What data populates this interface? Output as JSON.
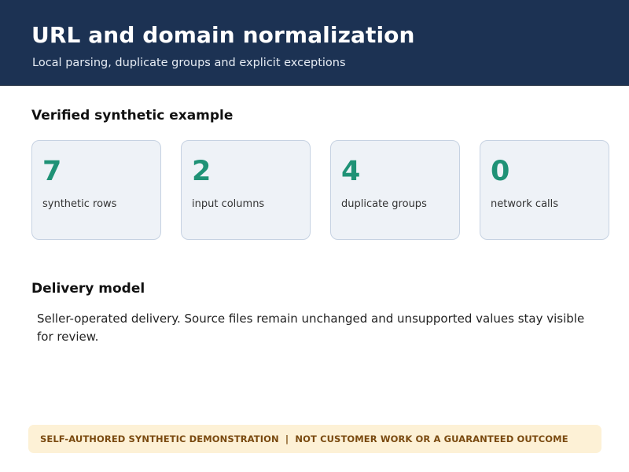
{
  "header": {
    "title": "URL and domain normalization",
    "subtitle": "Local parsing, duplicate groups and explicit exceptions"
  },
  "example": {
    "heading": "Verified synthetic example",
    "stats": [
      {
        "value": "7",
        "label": "synthetic rows"
      },
      {
        "value": "2",
        "label": "input columns"
      },
      {
        "value": "4",
        "label": "duplicate groups"
      },
      {
        "value": "0",
        "label": "network calls"
      }
    ]
  },
  "delivery": {
    "heading": "Delivery model",
    "text": "Seller-operated delivery. Source files remain unchanged and unsupported values stay visible for review."
  },
  "disclaimer": {
    "text": "SELF-AUTHORED SYNTHETIC DEMONSTRATION  |  NOT CUSTOMER WORK OR A GUARANTEED OUTCOME"
  },
  "colors": {
    "header_background": "#1c3253",
    "accent_value": "#1f9276",
    "card_background": "#eef2f7",
    "card_border": "#c6d2e2",
    "disclaimer_background": "#fdf1d6",
    "disclaimer_text": "#7a4a10"
  }
}
